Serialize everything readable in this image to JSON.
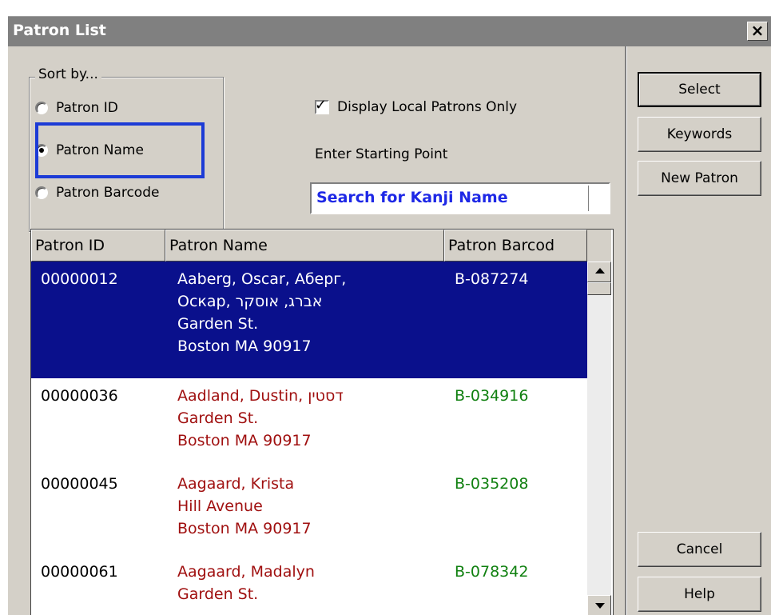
{
  "window": {
    "title": "Patron List",
    "close_glyph": "×"
  },
  "sort": {
    "legend": "Sort by...",
    "options": [
      {
        "label": "Patron ID",
        "selected": false
      },
      {
        "label": "Patron Name",
        "selected": true
      },
      {
        "label": "Patron Barcode",
        "selected": false
      }
    ]
  },
  "local_only": {
    "label": "Display Local Patrons Only",
    "checked": true
  },
  "search": {
    "label": "Enter Starting Point",
    "value": "Search for Kanji Name"
  },
  "table": {
    "columns": [
      "Patron ID",
      "Patron Name",
      "Patron Barcod"
    ],
    "rows": [
      {
        "id": "00000012",
        "name_lines": [
          "Aaberg, Oscar, Абepг,",
          "Оскар, אברג, אוסקר",
          "Garden St.",
          "Boston MA 90917"
        ],
        "barcode": "B-087274",
        "selected": true
      },
      {
        "id": "00000036",
        "name_lines": [
          "Aadland, Dustin, דסטין",
          "Garden St.",
          "Boston MA 90917"
        ],
        "barcode": "B-034916",
        "selected": false
      },
      {
        "id": "00000045",
        "name_lines": [
          "Aagaard, Krista",
          "Hill Avenue",
          "Boston MA 90917"
        ],
        "barcode": "B-035208",
        "selected": false
      },
      {
        "id": "00000061",
        "name_lines": [
          "Aagaard, Madalyn",
          "Garden St."
        ],
        "barcode": "B-078342",
        "selected": false
      }
    ]
  },
  "buttons": {
    "select": "Select",
    "keywords": "Keywords",
    "new_patron": "New Patron",
    "cancel": "Cancel",
    "help": "Help"
  },
  "colors": {
    "selection": "#0a108c",
    "name_text": "#a01010",
    "barcode_text": "#108010",
    "search_text": "#1e28e6",
    "focus_rect": "#1c3bd6"
  }
}
